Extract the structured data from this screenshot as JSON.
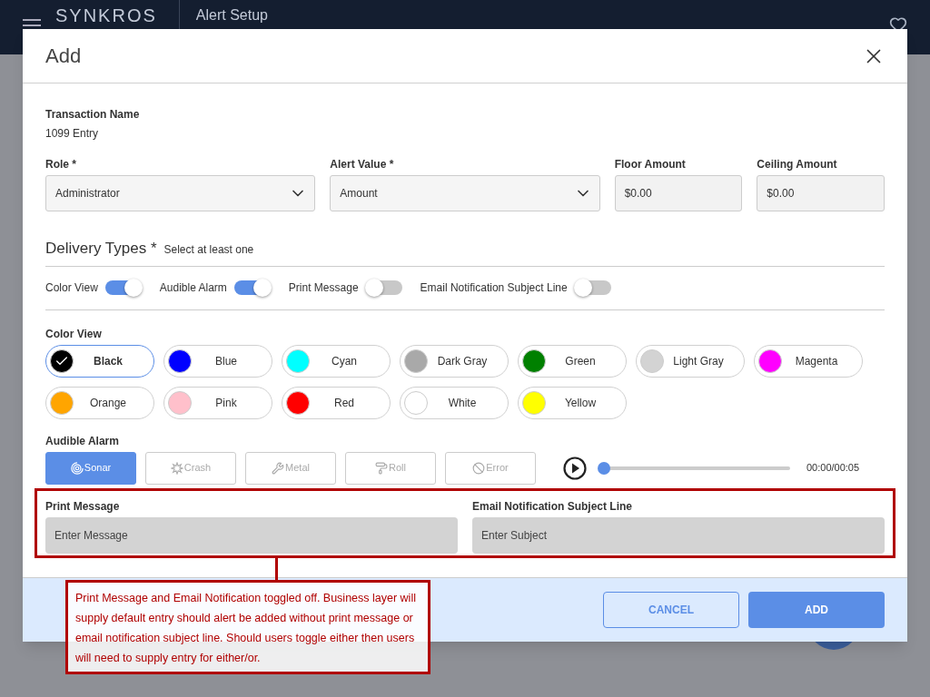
{
  "header": {
    "logo": "SYNKROS",
    "title": "Alert Setup"
  },
  "dialog": {
    "title": "Add",
    "transaction": {
      "label": "Transaction Name",
      "value": "1099 Entry"
    },
    "fields": [
      {
        "kind": "select",
        "label": "Role *",
        "value": "Administrator"
      },
      {
        "kind": "select",
        "label": "Alert Value *",
        "value": "Amount"
      },
      {
        "kind": "text",
        "label": "Floor Amount",
        "value": "$0.00"
      },
      {
        "kind": "text",
        "label": "Ceiling Amount",
        "value": "$0.00"
      }
    ],
    "delivery": {
      "title": "Delivery Types *",
      "hint": "Select at least one",
      "toggles": [
        {
          "label": "Color View",
          "on": true
        },
        {
          "label": "Audible Alarm",
          "on": true
        },
        {
          "label": "Print Message",
          "on": false
        },
        {
          "label": "Email Notification Subject Line",
          "on": false
        }
      ]
    },
    "color_view": {
      "label": "Color View",
      "colors": [
        {
          "label": "Black",
          "color": "#000000",
          "selected": true
        },
        {
          "label": "Blue",
          "color": "#0000ff",
          "selected": false
        },
        {
          "label": "Cyan",
          "color": "#00ffff",
          "selected": false
        },
        {
          "label": "Dark Gray",
          "color": "#a9a9a9",
          "selected": false
        },
        {
          "label": "Green",
          "color": "#008000",
          "selected": false
        },
        {
          "label": "Light Gray",
          "color": "#d3d3d3",
          "selected": false
        },
        {
          "label": "Magenta",
          "color": "#ff00ff",
          "selected": false
        },
        {
          "label": "Orange",
          "color": "#ffa500",
          "selected": false
        },
        {
          "label": "Pink",
          "color": "#ffc0cb",
          "selected": false
        },
        {
          "label": "Red",
          "color": "#ff0000",
          "selected": false
        },
        {
          "label": "White",
          "color": "#ffffff",
          "selected": false
        },
        {
          "label": "Yellow",
          "color": "#ffff00",
          "selected": false
        }
      ]
    },
    "audible_alarm": {
      "label": "Audible Alarm",
      "sounds": [
        {
          "label": "Sonar",
          "selected": true
        },
        {
          "label": "Crash",
          "selected": false
        },
        {
          "label": "Metal",
          "selected": false
        },
        {
          "label": "Roll",
          "selected": false
        },
        {
          "label": "Error",
          "selected": false
        }
      ],
      "player": {
        "level": 0,
        "time": "00:00/00:05"
      }
    },
    "message_fields": [
      {
        "label": "Print Message",
        "placeholder": "Enter Message"
      },
      {
        "label": "Email Notification Subject Line",
        "placeholder": "Enter Subject"
      }
    ],
    "buttons": [
      {
        "kind": "secondary",
        "label": "CANCEL"
      },
      {
        "kind": "primary",
        "label": "ADD"
      }
    ]
  },
  "annotation": {
    "text": "Print Message and Email Notification toggled off. Business layer will supply default entry should alert be added without print message or email notification subject line. Should users toggle either then users will need to supply entry for either/or."
  }
}
